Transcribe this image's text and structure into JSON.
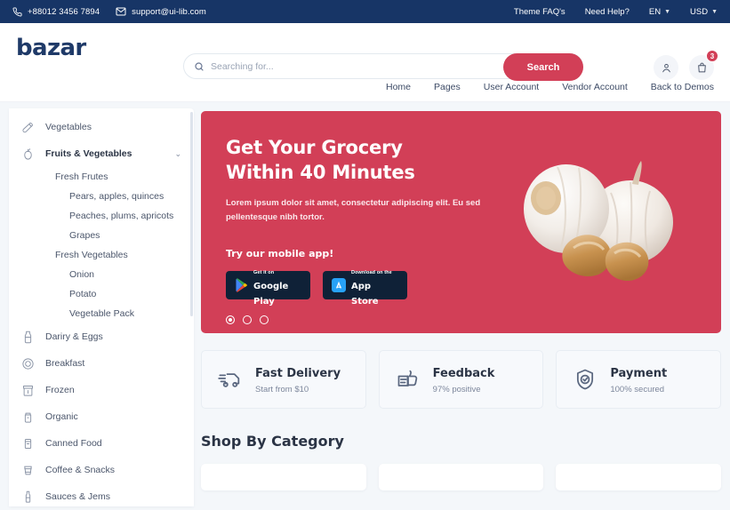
{
  "topbar": {
    "phone": "+88012 3456 7894",
    "email": "support@ui-lib.com",
    "phone_icon": "phone-icon",
    "email_icon": "envelope-icon",
    "links": [
      "Theme FAQ's",
      "Need Help?"
    ],
    "language": "EN",
    "currency": "USD",
    "bg_color": "#173566"
  },
  "header": {
    "logo": "bazar",
    "logo_color": "#1F3A68",
    "search": {
      "placeholder": "Searching for...",
      "value": "",
      "button_label": "Search",
      "button_color": "#D23F57",
      "icon": "search-icon"
    },
    "account_icon": "user-icon",
    "cart_icon": "bag-icon",
    "cart_count": "3"
  },
  "nav": {
    "items": [
      "Home",
      "Pages",
      "User Account",
      "Vendor Account",
      "Back to Demos"
    ]
  },
  "sidebar": {
    "items": [
      {
        "label": "Vegetables",
        "icon": "carrot-icon",
        "level": 0,
        "expandable": false
      },
      {
        "label": "Fruits & Vegetables",
        "icon": "apple-icon",
        "level": 0,
        "expandable": true,
        "chevron": "chevron-down-icon"
      },
      {
        "label": "Fresh Frutes",
        "level": 1
      },
      {
        "label": "Pears, apples, quinces",
        "level": 2
      },
      {
        "label": "Peaches, plums, apricots",
        "level": 2
      },
      {
        "label": "Grapes",
        "level": 2
      },
      {
        "label": "Fresh Vegetables",
        "level": 1
      },
      {
        "label": "Onion",
        "level": 2
      },
      {
        "label": "Potato",
        "level": 2
      },
      {
        "label": "Vegetable Pack",
        "level": 2
      },
      {
        "label": "Dariry & Eggs",
        "icon": "milk-bottle-icon",
        "level": 0,
        "expandable": false
      },
      {
        "label": "Breakfast",
        "icon": "cereal-icon",
        "level": 0,
        "expandable": false
      },
      {
        "label": "Frozen",
        "icon": "frozen-box-icon",
        "level": 0,
        "expandable": false
      },
      {
        "label": "Organic",
        "icon": "jar-icon",
        "level": 0,
        "expandable": false
      },
      {
        "label": "Canned Food",
        "icon": "can-icon",
        "level": 0,
        "expandable": false
      },
      {
        "label": "Coffee & Snacks",
        "icon": "coffee-icon",
        "level": 0,
        "expandable": false
      },
      {
        "label": "Sauces & Jems",
        "icon": "sauce-bottle-icon",
        "level": 0,
        "expandable": false
      }
    ]
  },
  "hero": {
    "title_line1": "Get Your Grocery",
    "title_line2": "Within 40 Minutes",
    "description": "Lorem ipsum dolor sit amet, consectetur adipiscing elit. Eu sed pellentesque nibh tortor.",
    "app_cta": "Try our mobile app!",
    "bg_color": "#D23F57",
    "image": "garlic-bulbs-photo",
    "stores": [
      {
        "small": "Get it on",
        "big": "Google Play",
        "icon": "google-play-icon"
      },
      {
        "small": "Download on the",
        "big": "App Store",
        "icon": "app-store-icon"
      }
    ],
    "carousel": {
      "total": 3,
      "active": 1
    }
  },
  "features": [
    {
      "title": "Fast Delivery",
      "subtitle": "Start from $10",
      "icon": "delivery-truck-icon"
    },
    {
      "title": "Feedback",
      "subtitle": "97% positive",
      "icon": "thumbs-up-icon"
    },
    {
      "title": "Payment",
      "subtitle": "100% secured",
      "icon": "shield-check-icon"
    }
  ],
  "shop_section": {
    "title": "Shop By Category",
    "cards_visible": 3
  }
}
